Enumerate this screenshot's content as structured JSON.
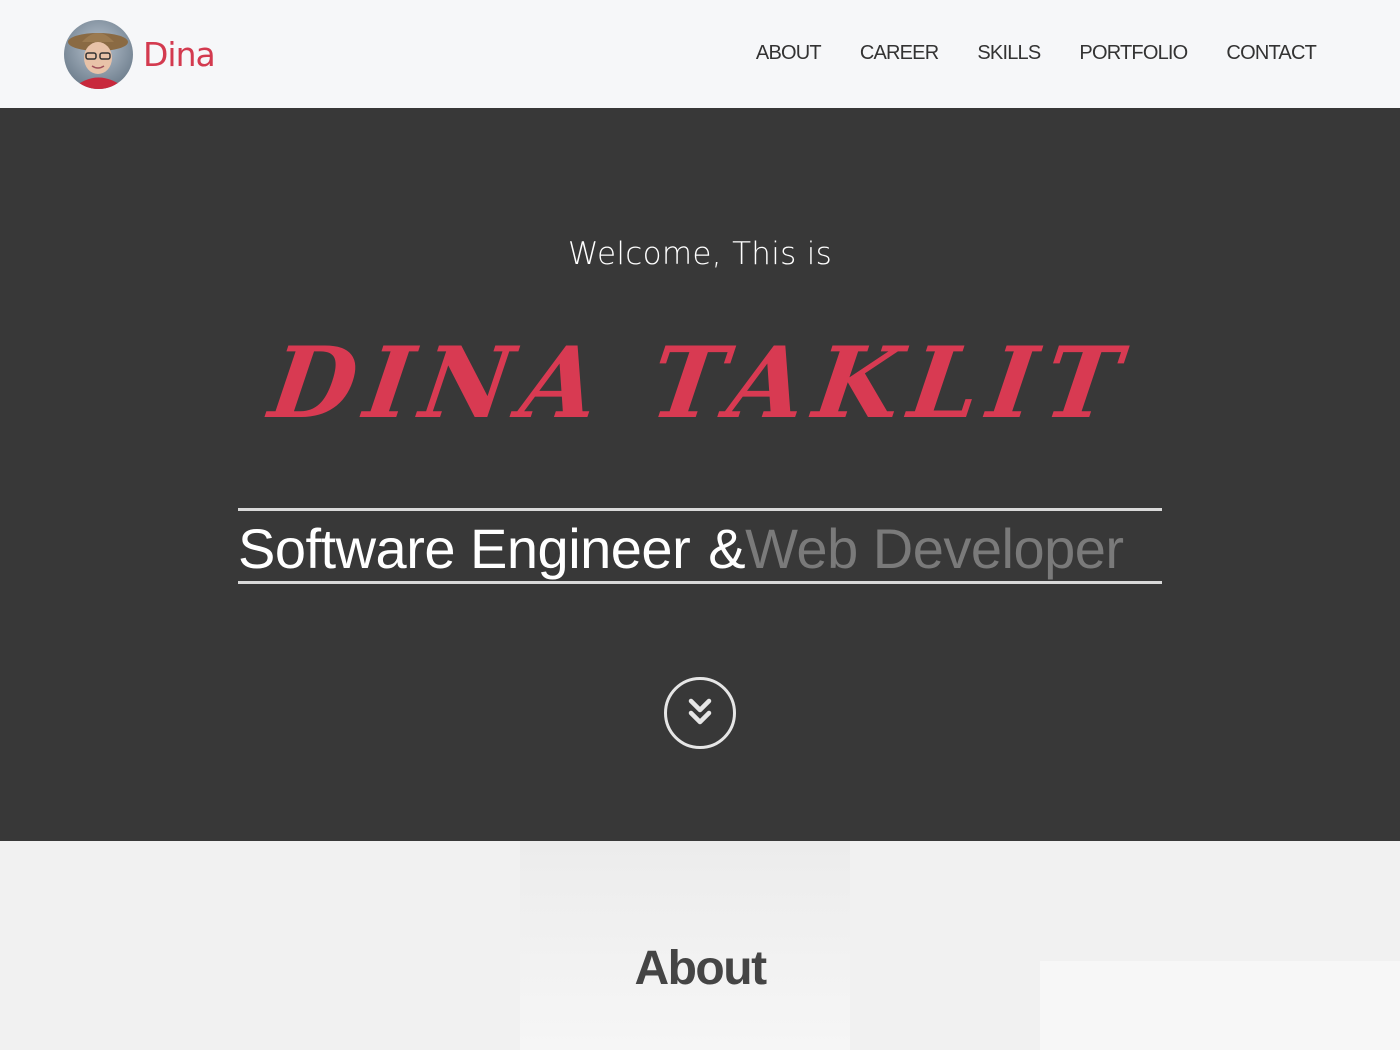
{
  "header": {
    "brand_name": "Dina",
    "avatar_icon": "profile-photo",
    "nav": {
      "about": "ABOUT",
      "career": "CAREER",
      "skills": "SKILLS",
      "portfolio": "PORTFOLIO",
      "contact": "CONTACT"
    }
  },
  "hero": {
    "welcome": "Welcome, This is",
    "name": "DINA TAKLIT",
    "role_main": "Software Engineer",
    "role_amp": "&",
    "role_typing": "Web Developer",
    "scroll_icon": "double-chevron-down-icon"
  },
  "about": {
    "title": "About"
  },
  "colors": {
    "accent": "#d83a52",
    "hero_bg": "#383838",
    "header_bg": "#f6f7f9"
  }
}
